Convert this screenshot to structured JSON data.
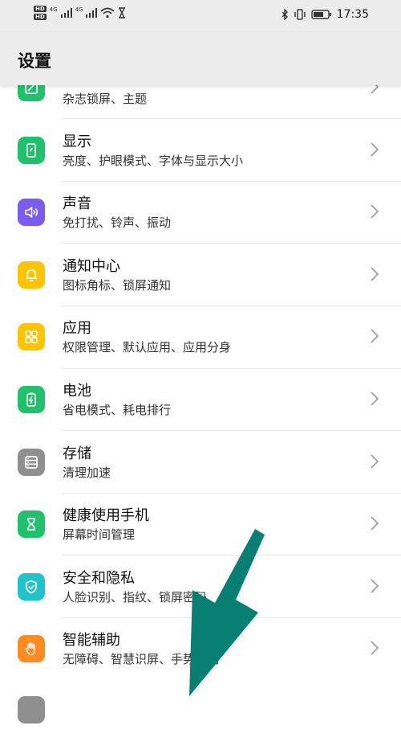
{
  "statusbar": {
    "hd1": "HD",
    "hd2": "HD",
    "net1": "4G",
    "net2": "4G",
    "time": "17:35",
    "icons": [
      "signal-icon",
      "wifi-icon",
      "hourglass-icon",
      "bluetooth-icon",
      "vibrate-icon",
      "battery-icon"
    ]
  },
  "header": {
    "title": "设置"
  },
  "items": [
    {
      "title": "",
      "subtitle": "杂志锁屏、主题",
      "icon": "theme-icon",
      "color": "#1fc26b"
    },
    {
      "title": "显示",
      "subtitle": "亮度、护眼模式、字体与显示大小",
      "icon": "display-icon",
      "color": "#1fc26b"
    },
    {
      "title": "声音",
      "subtitle": "免打扰、铃声、振动",
      "icon": "speaker-icon",
      "color": "#7b5cf0"
    },
    {
      "title": "通知中心",
      "subtitle": "图标角标、锁屏通知",
      "icon": "bell-icon",
      "color": "#ffc400"
    },
    {
      "title": "应用",
      "subtitle": "权限管理、默认应用、应用分身",
      "icon": "apps-grid-icon",
      "color": "#ffc400"
    },
    {
      "title": "电池",
      "subtitle": "省电模式、耗电排行",
      "icon": "battery-bolt-icon",
      "color": "#1fc26b"
    },
    {
      "title": "存储",
      "subtitle": "清理加速",
      "icon": "storage-icon",
      "color": "#8f8f8f"
    },
    {
      "title": "健康使用手机",
      "subtitle": "屏幕时间管理",
      "icon": "hourglass-icon",
      "color": "#1fc26b"
    },
    {
      "title": "安全和隐私",
      "subtitle": "人脸识别、指纹、锁屏密码",
      "icon": "shield-check-icon",
      "color": "#20c3c8"
    },
    {
      "title": "智能辅助",
      "subtitle": "无障碍、智慧识屏、手势控制",
      "icon": "hand-icon",
      "color": "#ff8a1f"
    }
  ],
  "colors": {
    "arrow": "#087f73"
  }
}
